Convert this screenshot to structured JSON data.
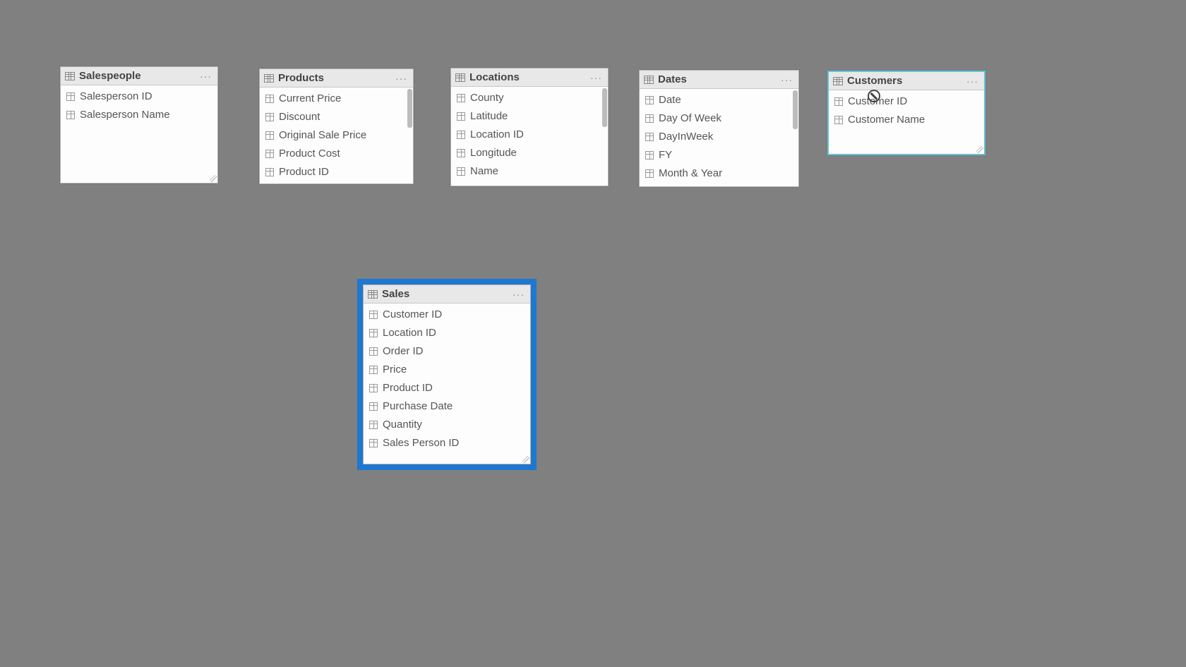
{
  "tables": {
    "salespeople": {
      "title": "Salespeople",
      "fields": [
        "Salesperson ID",
        "Salesperson Name"
      ]
    },
    "products": {
      "title": "Products",
      "fields": [
        "Current Price",
        "Discount",
        "Original Sale Price",
        "Product Cost",
        "Product ID"
      ]
    },
    "locations": {
      "title": "Locations",
      "fields": [
        "County",
        "Latitude",
        "Location ID",
        "Longitude",
        "Name"
      ]
    },
    "dates": {
      "title": "Dates",
      "fields": [
        "Date",
        "Day Of Week",
        "DayInWeek",
        "FY",
        "Month & Year"
      ]
    },
    "customers": {
      "title": "Customers",
      "fields": [
        "Customer ID",
        "Customer Name"
      ]
    },
    "sales": {
      "title": "Sales",
      "fields": [
        "Customer ID",
        "Location ID",
        "Order ID",
        "Price",
        "Product ID",
        "Purchase Date",
        "Quantity",
        "Sales Person ID"
      ]
    }
  },
  "menu_label": "···"
}
